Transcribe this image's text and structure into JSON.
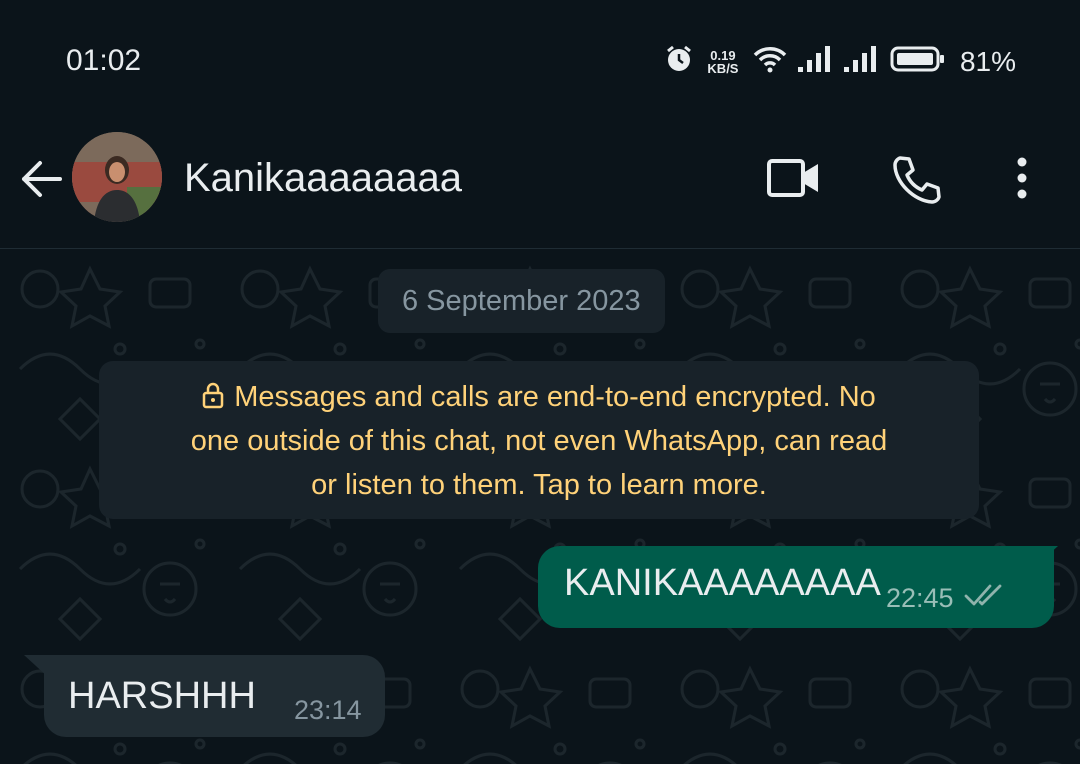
{
  "status_bar": {
    "time": "01:02",
    "net_speed_value": "0.19",
    "net_speed_unit": "KB/S",
    "battery_percent": "81%",
    "icons": [
      "alarm-icon",
      "wifi-icon",
      "signal-icon",
      "signal-icon",
      "battery-icon"
    ]
  },
  "header": {
    "contact_name": "Kanikaaaaaaaa",
    "icons": [
      "back-arrow-icon",
      "avatar",
      "video-call-icon",
      "voice-call-icon",
      "more-options-icon"
    ]
  },
  "chat": {
    "date_label": "6 September 2023",
    "encryption_notice_line1": "Messages and calls are end-to-end encrypted. No",
    "encryption_notice_line2": "one outside of this chat, not even WhatsApp, can read",
    "encryption_notice_line3": "or listen to them. Tap to learn more.",
    "messages": [
      {
        "direction": "outgoing",
        "text": "KANIKAAAAAAAA",
        "time": "22:45",
        "status": "read"
      },
      {
        "direction": "incoming",
        "text": "HARSHHH",
        "time": "23:14"
      }
    ]
  },
  "colors": {
    "background": "#0b141a",
    "outgoing_bubble": "#005c4b",
    "incoming_bubble": "#202c33",
    "notice_text": "#ffd279"
  }
}
